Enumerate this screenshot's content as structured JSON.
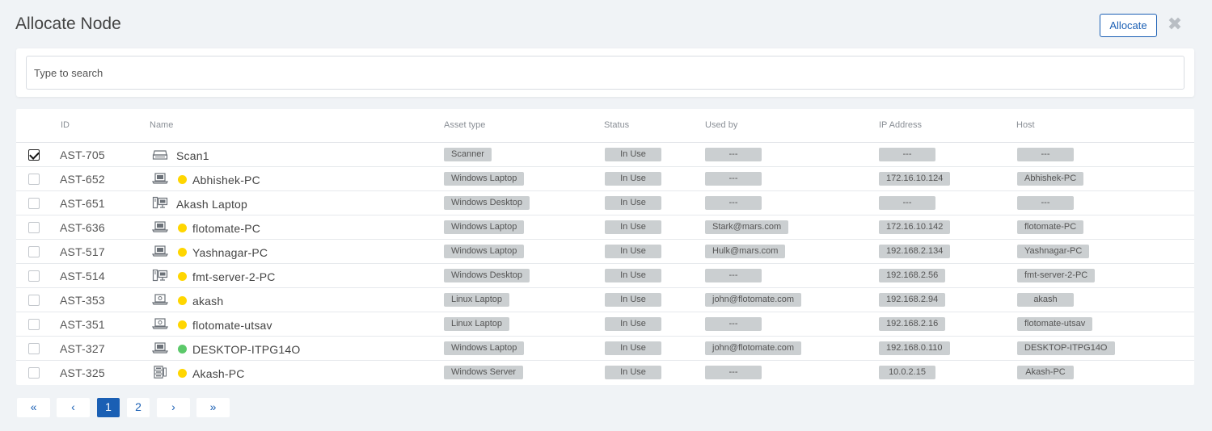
{
  "dialog": {
    "title": "Allocate Node",
    "allocate_label": "Allocate",
    "close_glyph": "✖"
  },
  "search": {
    "placeholder": "Type to search",
    "value": ""
  },
  "table": {
    "columns": {
      "id": "ID",
      "name": "Name",
      "asset_type": "Asset type",
      "status": "Status",
      "used_by": "Used by",
      "ip": "IP Address",
      "host": "Host"
    },
    "rows": [
      {
        "checked": true,
        "id": "AST-705",
        "icon": "scanner-icon",
        "dot": null,
        "name": "Scan1",
        "asset_type": "Scanner",
        "status": "In Use",
        "used_by": "---",
        "ip": "---",
        "host": "---"
      },
      {
        "checked": false,
        "id": "AST-652",
        "icon": "laptop-icon",
        "dot": "#ffd600",
        "name": "Abhishek-PC",
        "asset_type": "Windows Laptop",
        "status": "In Use",
        "used_by": "---",
        "ip": "172.16.10.124",
        "host": "Abhishek-PC"
      },
      {
        "checked": false,
        "id": "AST-651",
        "icon": "desktop-icon",
        "dot": null,
        "name": "Akash Laptop",
        "asset_type": "Windows Desktop",
        "status": "In Use",
        "used_by": "---",
        "ip": "---",
        "host": "---"
      },
      {
        "checked": false,
        "id": "AST-636",
        "icon": "laptop-icon",
        "dot": "#ffd600",
        "name": "flotomate-PC",
        "asset_type": "Windows Laptop",
        "status": "In Use",
        "used_by": "Stark@mars.com",
        "ip": "172.16.10.142",
        "host": "flotomate-PC"
      },
      {
        "checked": false,
        "id": "AST-517",
        "icon": "laptop-icon",
        "dot": "#ffd600",
        "name": "Yashnagar-PC",
        "asset_type": "Windows Laptop",
        "status": "In Use",
        "used_by": "Hulk@mars.com",
        "ip": "192.168.2.134",
        "host": "Yashnagar-PC"
      },
      {
        "checked": false,
        "id": "AST-514",
        "icon": "desktop-icon",
        "dot": "#ffd600",
        "name": "fmt-server-2-PC",
        "asset_type": "Windows Desktop",
        "status": "In Use",
        "used_by": "---",
        "ip": "192.168.2.56",
        "host": "fmt-server-2-PC"
      },
      {
        "checked": false,
        "id": "AST-353",
        "icon": "linux-laptop-icon",
        "dot": "#ffd600",
        "name": "akash",
        "asset_type": "Linux Laptop",
        "status": "In Use",
        "used_by": "john@flotomate.com",
        "ip": "192.168.2.94",
        "host": "akash"
      },
      {
        "checked": false,
        "id": "AST-351",
        "icon": "linux-laptop-icon",
        "dot": "#ffd600",
        "name": "flotomate-utsav",
        "asset_type": "Linux Laptop",
        "status": "In Use",
        "used_by": "---",
        "ip": "192.168.2.16",
        "host": "flotomate-utsav"
      },
      {
        "checked": false,
        "id": "AST-327",
        "icon": "laptop-icon",
        "dot": "#5cc96a",
        "name": "DESKTOP-ITPG14O",
        "asset_type": "Windows Laptop",
        "status": "In Use",
        "used_by": "john@flotomate.com",
        "ip": "192.168.0.110",
        "host": "DESKTOP-ITPG14O"
      },
      {
        "checked": false,
        "id": "AST-325",
        "icon": "server-icon",
        "dot": "#ffd600",
        "name": "Akash-PC",
        "asset_type": "Windows Server",
        "status": "In Use",
        "used_by": "---",
        "ip": "10.0.2.15",
        "host": "Akash-PC"
      }
    ]
  },
  "pagination": {
    "first": "«",
    "prev": "‹",
    "pages": [
      "1",
      "2"
    ],
    "current": "1",
    "next": "›",
    "last": "»"
  },
  "colors": {
    "accent": "#1a5fb4",
    "online": "#5cc96a",
    "warning": "#ffd600",
    "pill_bg": "#cbcfd1"
  }
}
